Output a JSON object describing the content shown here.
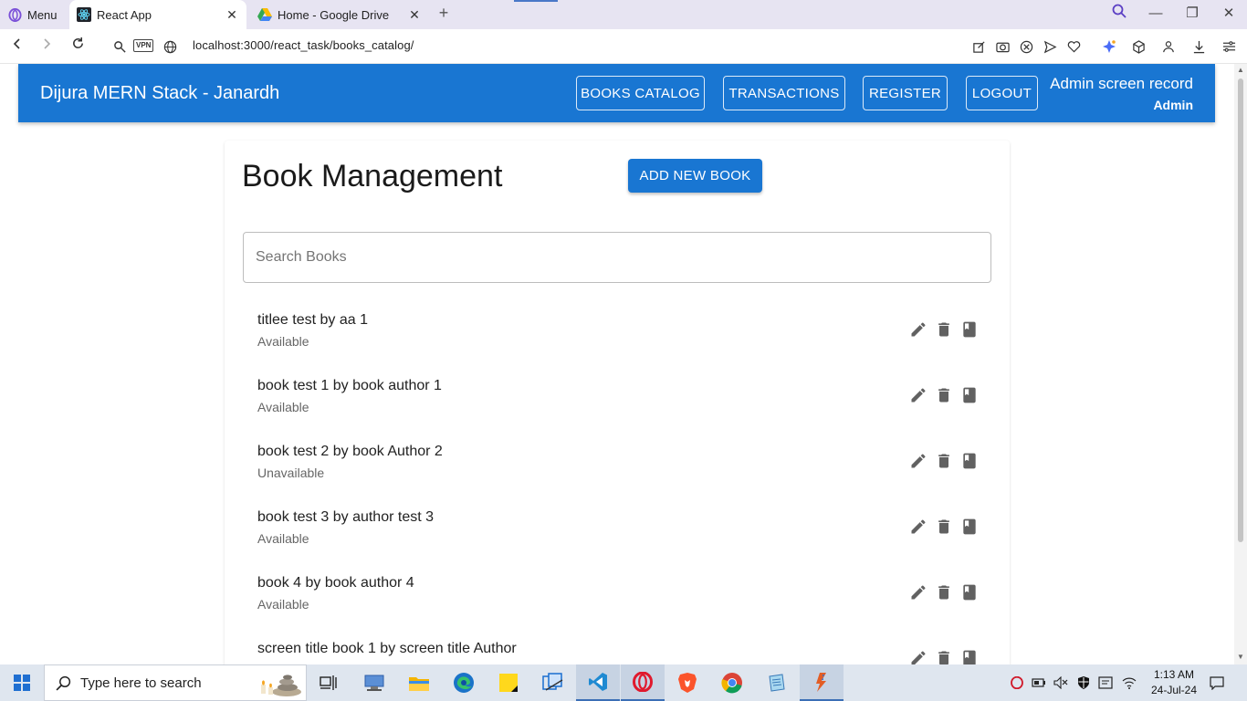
{
  "browser": {
    "menu_label": "Menu",
    "tabs": [
      {
        "title": "React App"
      },
      {
        "title": "Home - Google Drive"
      }
    ],
    "vpn_label": "VPN",
    "url": "localhost:3000/react_task/books_catalog/"
  },
  "appbar": {
    "title": "Dijura MERN Stack - Janardh",
    "nav": [
      {
        "label": "BOOKS CATALOG"
      },
      {
        "label": "TRANSACTIONS"
      },
      {
        "label": "REGISTER"
      },
      {
        "label": "LOGOUT"
      }
    ],
    "user_name": "Admin screen record",
    "user_role": "Admin"
  },
  "page": {
    "title": "Book Management",
    "add_button": "ADD NEW BOOK",
    "search_placeholder": "Search Books",
    "books": [
      {
        "title": "titlee test by aa 1",
        "status": "Available"
      },
      {
        "title": "book test 1 by book author 1",
        "status": "Available"
      },
      {
        "title": "book test 2 by book Author 2",
        "status": "Unavailable"
      },
      {
        "title": "book test 3 by author test 3",
        "status": "Available"
      },
      {
        "title": "book 4 by book author 4",
        "status": "Available"
      },
      {
        "title": "screen title book 1 by screen title Author",
        "status": ""
      }
    ],
    "row_icons": [
      "edit-icon",
      "delete-icon",
      "book-icon"
    ]
  },
  "taskbar": {
    "search_placeholder": "Type here to search",
    "time": "1:13 AM",
    "date": "24-Jul-24"
  },
  "colors": {
    "primary": "#1976d2",
    "icon_grey": "#616161"
  }
}
